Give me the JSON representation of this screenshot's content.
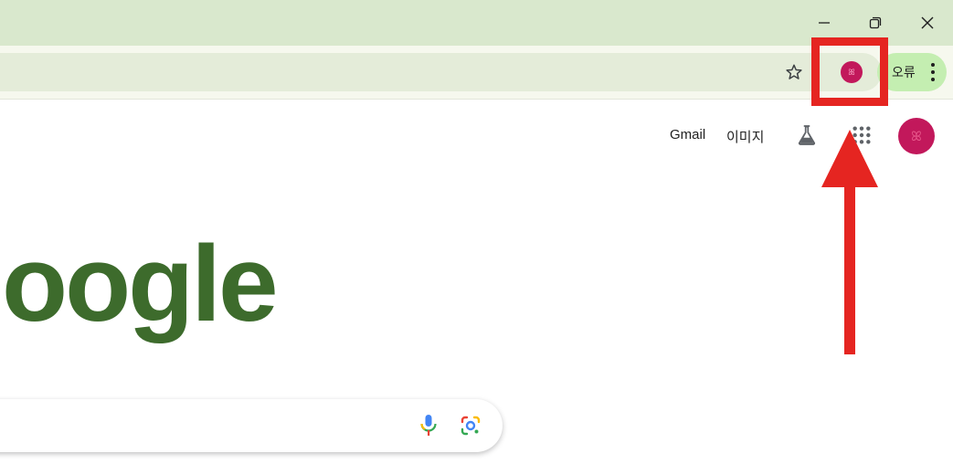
{
  "window_controls": {
    "icons": [
      "minimize-icon",
      "restore-icon",
      "close-icon"
    ]
  },
  "toolbar": {
    "bookmark_icon": "star-icon",
    "profile_icon": "profile-avatar-icon",
    "error_chip_label": "오류",
    "menu_icon": "kebab-menu-icon"
  },
  "google_header": {
    "gmail_link": "Gmail",
    "images_link": "이미지",
    "labs_icon": "flask-icon",
    "apps_icon": "apps-grid-icon",
    "account_icon": "account-avatar-icon"
  },
  "logo": {
    "visible_text": "oogle",
    "color": "#3d6b2c"
  },
  "search": {
    "mic_icon": "microphone-icon",
    "lens_icon": "google-lens-icon"
  },
  "annotation": {
    "highlight_color": "#e52521",
    "arrow_direction": "up"
  },
  "colors": {
    "titlebar": "#d9e8cd",
    "toolbar": "#f6f8ee",
    "omnibox": "#e4ecd9",
    "error_chip": "#c4eeb1",
    "avatar": "#c2185b"
  }
}
